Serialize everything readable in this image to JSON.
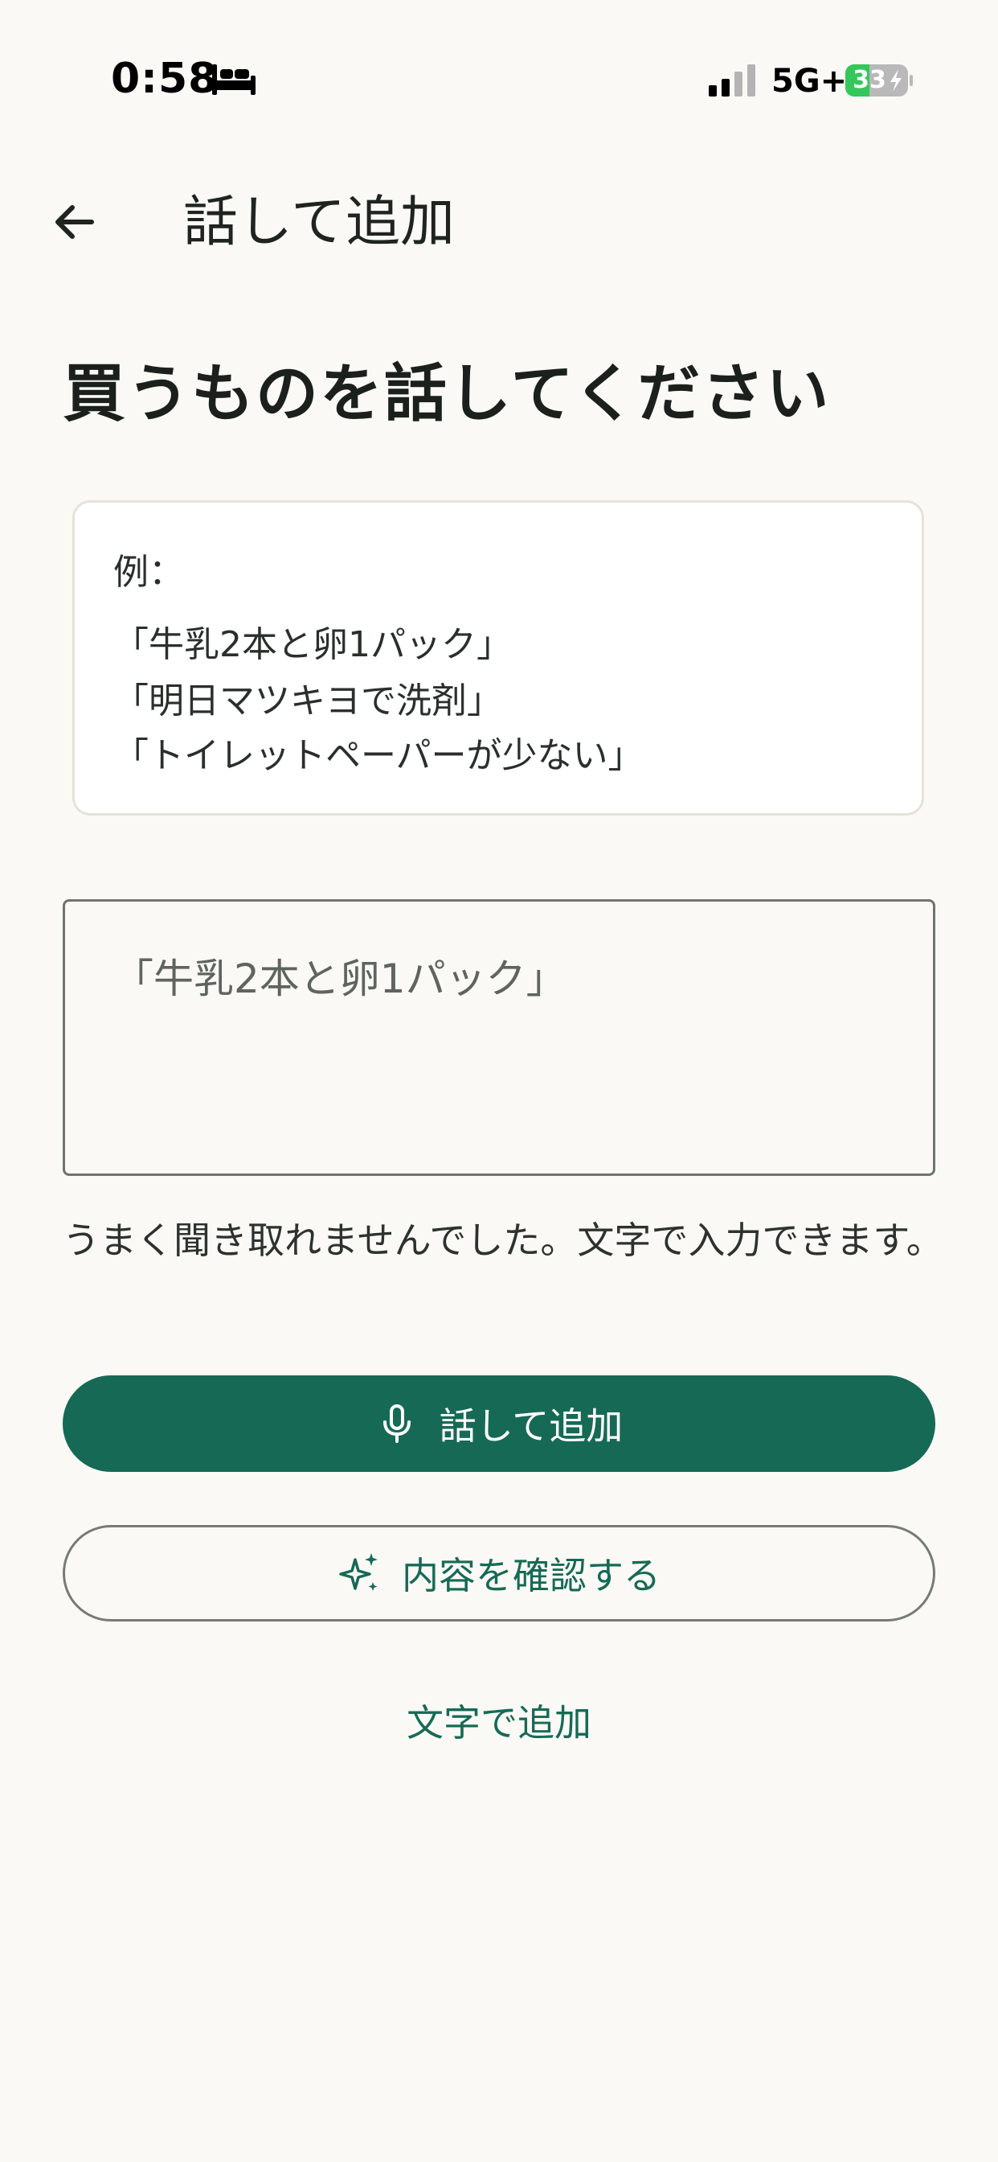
{
  "status_bar": {
    "time": "0:58",
    "network": "5G+",
    "battery": "33",
    "icons": [
      "bed-icon",
      "signal-icon",
      "battery-charging-icon"
    ]
  },
  "header": {
    "title": "話して追加",
    "back_icon": "arrow-left-icon"
  },
  "main": {
    "heading": "買うものを話してください",
    "examples": {
      "label": "例：",
      "lines": [
        "「牛乳2本と卵1パック」",
        "「明日マツキヨで洗剤」",
        "「トイレットペーパーが少ない」"
      ]
    },
    "input": {
      "placeholder": "「牛乳2本と卵1パック」"
    },
    "error_message": "うまく聞き取れませんでした。文字で入力できます。",
    "speak_button": {
      "label": "話して追加",
      "icon": "microphone-icon"
    },
    "confirm_button": {
      "label": "内容を確認する",
      "icon": "sparkle-icon"
    },
    "text_link": "文字で追加"
  },
  "colors": {
    "background": "#faf9f6",
    "primary": "#166a55",
    "battery_green": "#34c759"
  }
}
